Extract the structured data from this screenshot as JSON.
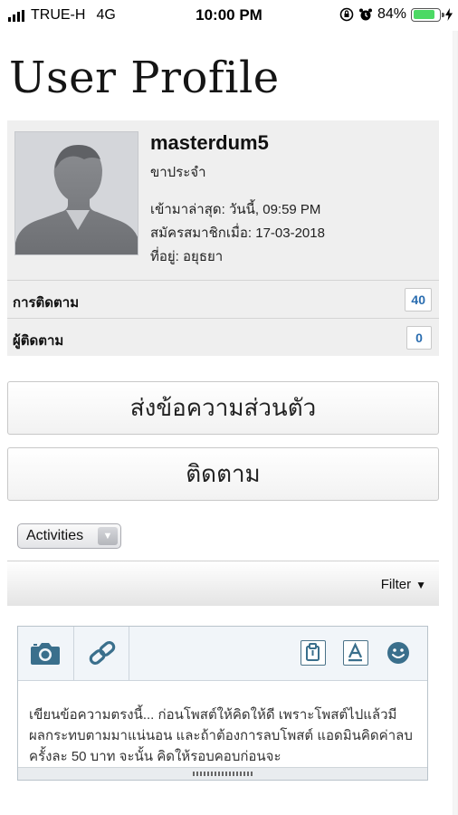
{
  "status_bar": {
    "carrier": "TRUE-H",
    "network": "4G",
    "time": "10:00 PM",
    "battery_percent": "84%",
    "battery_level": 0.84
  },
  "page": {
    "title": "User Profile"
  },
  "profile": {
    "username": "masterdum5",
    "rank": "ขาประจำ",
    "last_activity": "เข้ามาล่าสุด: วันนี้, 09:59 PM",
    "joined": "สมัครสมาชิกเมื่อ: 17-03-2018",
    "location": "ที่อยู่: อยุธยา"
  },
  "stats": {
    "following_label": "การติดตาม",
    "following_count": "40",
    "followers_label": "ผู้ติดตาม",
    "followers_count": "0"
  },
  "actions": {
    "private_message_label": "ส่งข้อความส่วนตัว",
    "follow_label": "ติดตาม"
  },
  "activities": {
    "selected": "Activities",
    "filter_label": "Filter"
  },
  "editor": {
    "placeholder": "เขียนข้อความตรงนี้... ก่อนโพสต์ให้คิดให้ดี เพราะโพสต์ไปแล้วมีผลกระทบตามมาแน่นอน และถ้าต้องการลบโพสต์ แอดมินคิดค่าลบครั้งละ 50 บาท จะนั้น คิดให้รอบคอบก่อนจะ",
    "toolbar_left": [
      "camera-icon",
      "link-icon"
    ],
    "toolbar_right": [
      "attach-icon",
      "text-format-icon",
      "emoji-icon"
    ]
  },
  "colors": {
    "count_blue": "#2a6db0",
    "icon_blue": "#3a6f8c",
    "battery_green": "#4cd964"
  }
}
